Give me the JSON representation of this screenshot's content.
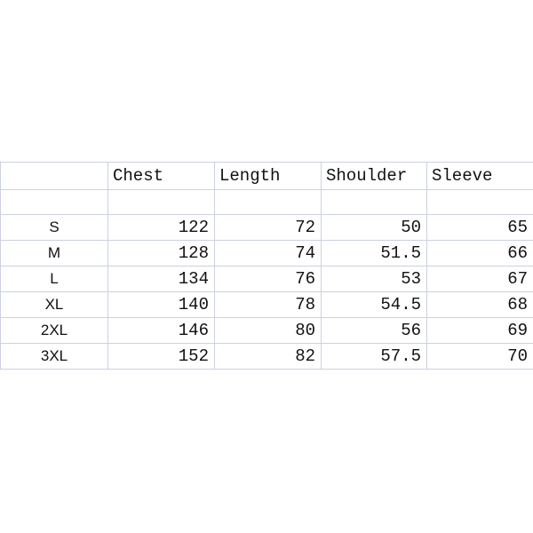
{
  "table": {
    "headers": [
      "",
      "Chest",
      "Length",
      "Shoulder",
      "Sleeve"
    ],
    "spacer_row": [
      "",
      "",
      "",
      "",
      ""
    ],
    "rows": [
      {
        "size": "S",
        "chest": "122",
        "length": "72",
        "shoulder": "50",
        "sleeve": "65"
      },
      {
        "size": "M",
        "chest": "128",
        "length": "74",
        "shoulder": "51.5",
        "sleeve": "66"
      },
      {
        "size": "L",
        "chest": "134",
        "length": "76",
        "shoulder": "53",
        "sleeve": "67"
      },
      {
        "size": "XL",
        "chest": "140",
        "length": "78",
        "shoulder": "54.5",
        "sleeve": "68"
      },
      {
        "size": "2XL",
        "chest": "146",
        "length": "80",
        "shoulder": "56",
        "sleeve": "69"
      },
      {
        "size": "3XL",
        "chest": "152",
        "length": "82",
        "shoulder": "57.5",
        "sleeve": "70"
      }
    ]
  },
  "colors": {
    "background": "#ffffff",
    "gridline": "#ccd1e3",
    "text": "#111111"
  }
}
